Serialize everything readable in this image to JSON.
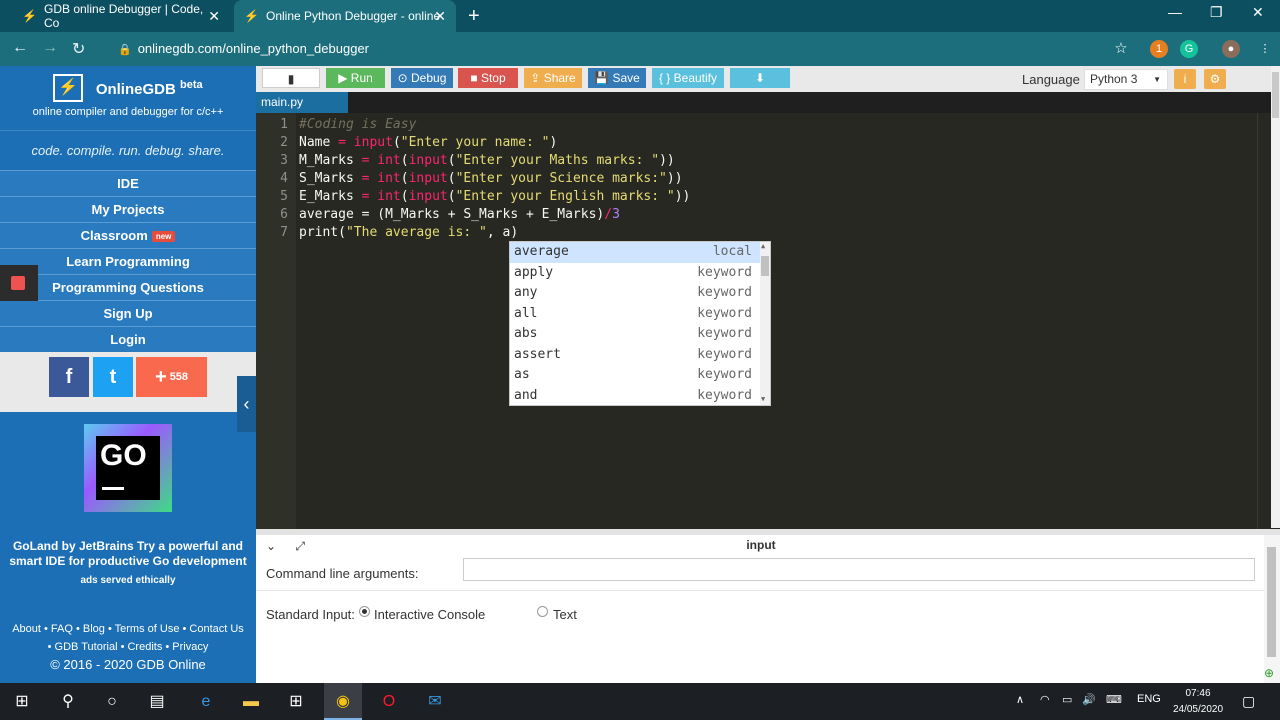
{
  "browser": {
    "tabs": [
      {
        "title": "GDB online Debugger | Code, Co",
        "active": false
      },
      {
        "title": "Online Python Debugger - online",
        "active": true
      }
    ],
    "url": "onlinegdb.com/online_python_debugger",
    "extension_badge": "1"
  },
  "sidebar": {
    "brand": "OnlineGDB",
    "brand_sup": "beta",
    "tagline": "online compiler and debugger for c/c++",
    "motto": "code. compile. run. debug. share.",
    "nav": [
      {
        "label": "IDE"
      },
      {
        "label": "My Projects"
      },
      {
        "label": "Classroom",
        "badge": "new"
      },
      {
        "label": "Learn Programming"
      },
      {
        "label": "Programming Questions"
      },
      {
        "label": "Sign Up"
      },
      {
        "label": "Login"
      }
    ],
    "social": {
      "facebook": "f",
      "twitter": "t",
      "share_count": "558"
    },
    "ad": {
      "logo_text": "GO",
      "text": "GoLand by JetBrains Try a powerful and smart IDE for productive Go development",
      "note": "ads served ethically"
    },
    "footer": {
      "line1": "About • FAQ • Blog • Terms of Use • Contact Us",
      "line2": "• GDB Tutorial • Credits • Privacy",
      "copyright": "© 2016 - 2020 GDB Online"
    }
  },
  "toolbar": {
    "run": "Run",
    "debug": "Debug",
    "stop": "Stop",
    "share": "Share",
    "save": "Save",
    "beautify": "{ } Beautify",
    "language_label": "Language",
    "language_value": "Python 3",
    "colors": {
      "run": "#5cb85c",
      "debug": "#337ab7",
      "stop": "#d9534f",
      "share": "#f0ad4e",
      "save": "#337ab7",
      "beautify": "#5bc0de",
      "download": "#5bc0de"
    }
  },
  "editor": {
    "file_tab": "main.py",
    "lines": [
      {
        "n": "1"
      },
      {
        "n": "2"
      },
      {
        "n": "3"
      },
      {
        "n": "4"
      },
      {
        "n": "5"
      },
      {
        "n": "6"
      },
      {
        "n": "7"
      }
    ],
    "code": {
      "l1": "#Coding is Easy",
      "l2_var": "Name",
      "l2_eq": " = ",
      "l2_fn": "input",
      "l2_str": "\"Enter your name: \"",
      "l3_var": "M_Marks",
      "l3_str": "\"Enter your Maths marks: \"",
      "l4_var": "S_Marks",
      "l4_str": "\"Enter your Science marks:\"",
      "l5_var": "E_Marks",
      "l5_str": "\"Enter your English marks: \"",
      "eq": " = ",
      "int": "int",
      "input": "input",
      "open": "(",
      "close2": "))",
      "l6_a": "average = (M_Marks + S_Marks + E_Marks)",
      "l6_op": "/",
      "l6_num": "3",
      "l7_fn": "print(",
      "l7_str": "\"The average is: \"",
      "l7_rest": ", a)"
    },
    "autocomplete": [
      {
        "word": "average",
        "meta": "local"
      },
      {
        "word": "apply",
        "meta": "keyword"
      },
      {
        "word": "any",
        "meta": "keyword"
      },
      {
        "word": "all",
        "meta": "keyword"
      },
      {
        "word": "abs",
        "meta": "keyword"
      },
      {
        "word": "assert",
        "meta": "keyword"
      },
      {
        "word": "as",
        "meta": "keyword"
      },
      {
        "word": "and",
        "meta": "keyword"
      }
    ]
  },
  "input_panel": {
    "title": "input",
    "cla_label": "Command line arguments:",
    "stdin_label": "Standard Input:",
    "option_interactive": "Interactive Console",
    "option_text": "Text",
    "selected": "Interactive Console"
  },
  "taskbar": {
    "lang": "ENG",
    "time": "07:46",
    "date": "24/05/2020"
  }
}
